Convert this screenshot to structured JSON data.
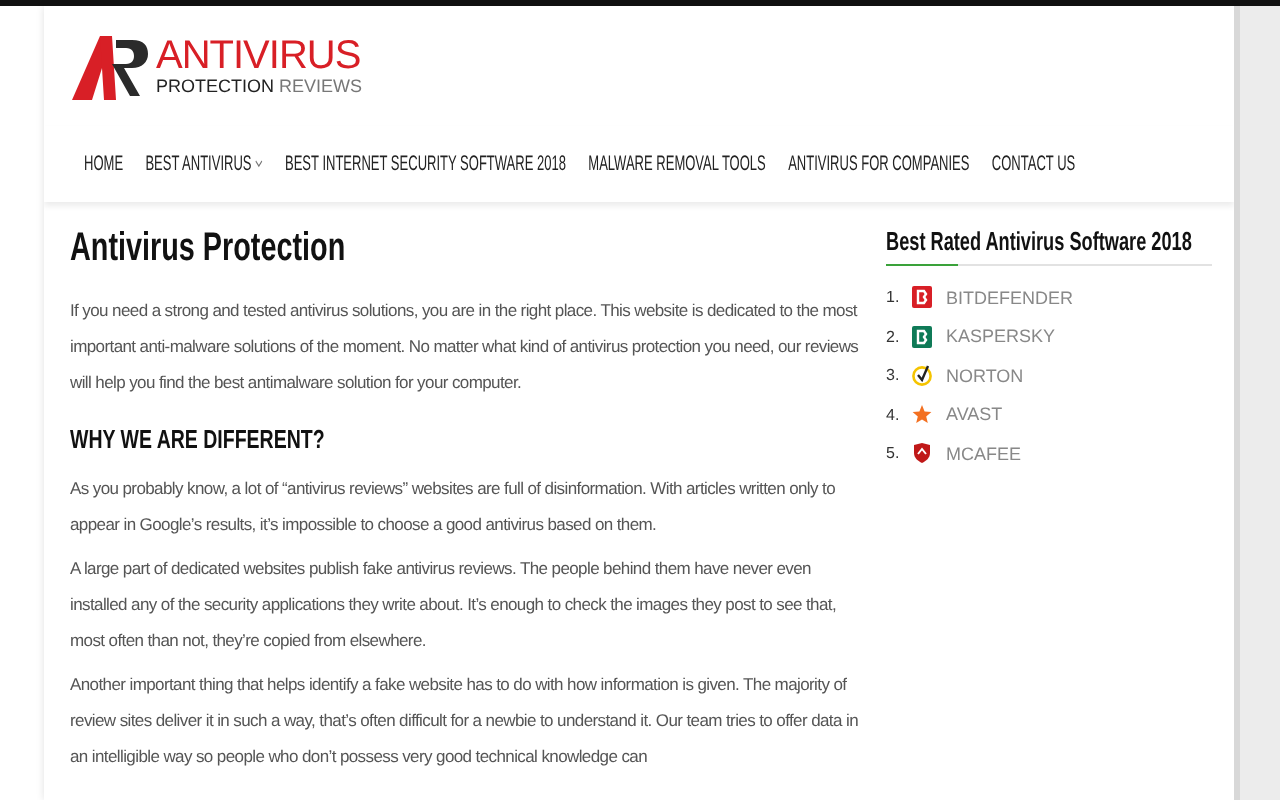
{
  "logo": {
    "title": "ANTIVIRUS",
    "subtitle_strong": "PROTECTION",
    "subtitle_light": "REVIEWS"
  },
  "nav": [
    {
      "label": "HOME",
      "has_dropdown": false
    },
    {
      "label": "BEST ANTIVIRUS",
      "has_dropdown": true
    },
    {
      "label": "BEST INTERNET SECURITY SOFTWARE 2018",
      "has_dropdown": false
    },
    {
      "label": "MALWARE REMOVAL TOOLS",
      "has_dropdown": false
    },
    {
      "label": "ANTIVIRUS FOR COMPANIES",
      "has_dropdown": false
    },
    {
      "label": "CONTACT US",
      "has_dropdown": false
    }
  ],
  "article": {
    "title": "Antivirus Protection",
    "intro": "If you need a strong and tested antivirus solutions, you are in the right place. This website is dedicated to the most important anti-malware solutions of the moment. No matter what kind of antivirus protection you need, our reviews will help you find the best antimalware solution for your computer.",
    "subheading": "WHY WE ARE DIFFERENT?",
    "paragraphs": [
      "As you probably know, a lot of “antivirus reviews” websites are full of disinformation. With articles written only to appear in Google’s results, it’s impossible to choose a good antivirus based on them.",
      "A large part of dedicated websites publish fake antivirus reviews. The people behind them have never even installed any of the security applications they write about. It’s enough to check the images they post to see that, most often than not, they’re copied from elsewhere.",
      "Another important thing that helps identify a fake website has to do with how information is given. The majority of review sites deliver it in such a way, that’s often difficult for a newbie to understand it. Our team tries to offer data in an intelligible way so people who don’t possess very good technical knowledge can"
    ]
  },
  "sidebar": {
    "title": "Best Rated Antivirus Software 2018",
    "items": [
      {
        "rank": "1.",
        "name": "BITDEFENDER",
        "kind": "square",
        "color": "#d81f26"
      },
      {
        "rank": "2.",
        "name": "KASPERSKY",
        "kind": "square",
        "color": "#0f7a57"
      },
      {
        "rank": "3.",
        "name": "NORTON",
        "kind": "check",
        "color": "#f5c400"
      },
      {
        "rank": "4.",
        "name": "AVAST",
        "kind": "star",
        "color": "#f37021"
      },
      {
        "rank": "5.",
        "name": "MCAFEE",
        "kind": "shield",
        "color": "#c01818"
      }
    ]
  }
}
